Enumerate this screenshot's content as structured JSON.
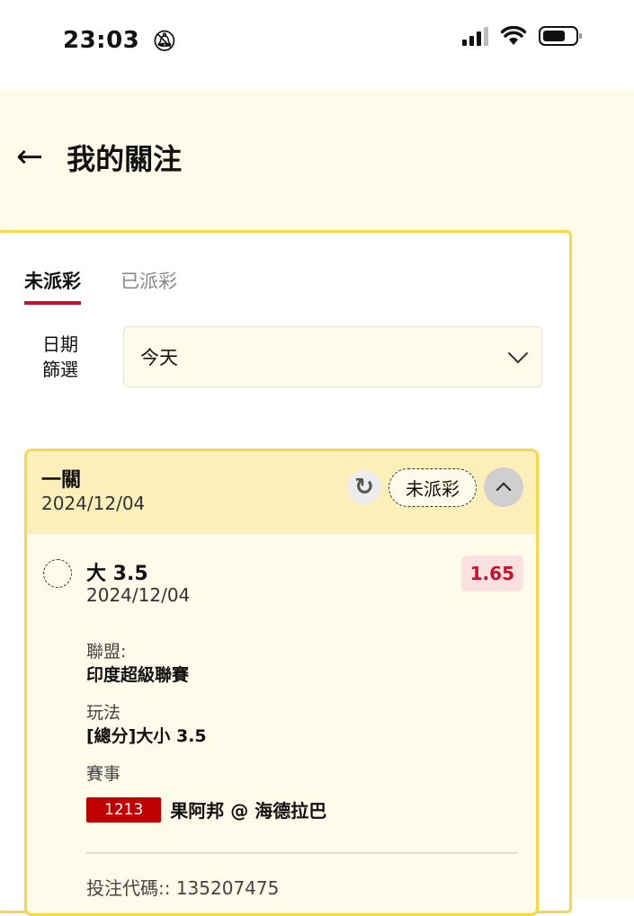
{
  "status_bar": {
    "time": "23:03",
    "bell_icon": "bell-slash-icon"
  },
  "header": {
    "back_icon": "←",
    "title": "我的關注"
  },
  "tabs": [
    {
      "label": "未派彩",
      "active": true
    },
    {
      "label": "已派彩",
      "active": false
    }
  ],
  "date_filter": {
    "label_line1": "日期",
    "label_line2": "篩選",
    "selected": "今天"
  },
  "bet": {
    "type": "一關",
    "date": "2024/12/04",
    "status": "未派彩",
    "selection": {
      "name": "大 3.5",
      "date": "2024/12/04",
      "odds": "1.65",
      "league_label": "聯盟:",
      "league": "印度超級聯賽",
      "play_label": "玩法",
      "play": "[總分]大小 3.5",
      "match_label": "賽事",
      "match_id": "1213",
      "match": "果阿邦 @ 海德拉巴"
    },
    "bet_code": "投注代碼:: 135207475"
  },
  "colors": {
    "accent_red": "#c8102e",
    "border_yellow": "#f8d74a",
    "bg_cream": "#fffbea"
  }
}
